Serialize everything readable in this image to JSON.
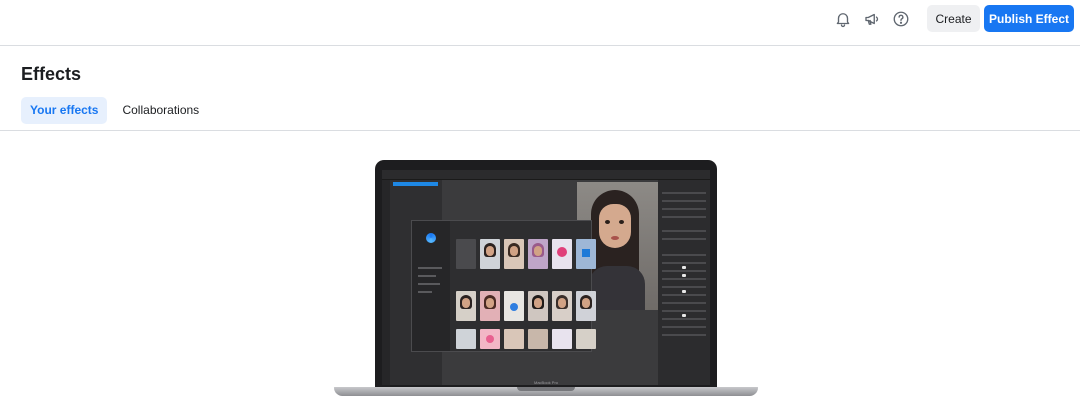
{
  "topbar": {
    "icons": [
      "bell-icon",
      "megaphone-icon",
      "help-circle-icon"
    ],
    "create_label": "Create",
    "publish_label": "Publish Effect",
    "accent_color": "#1877f2"
  },
  "page": {
    "title": "Effects",
    "tabs": [
      {
        "label": "Your effects",
        "active": true
      },
      {
        "label": "Collaborations",
        "active": false
      }
    ]
  },
  "illustration": {
    "device_label": "MacBook Pro"
  }
}
